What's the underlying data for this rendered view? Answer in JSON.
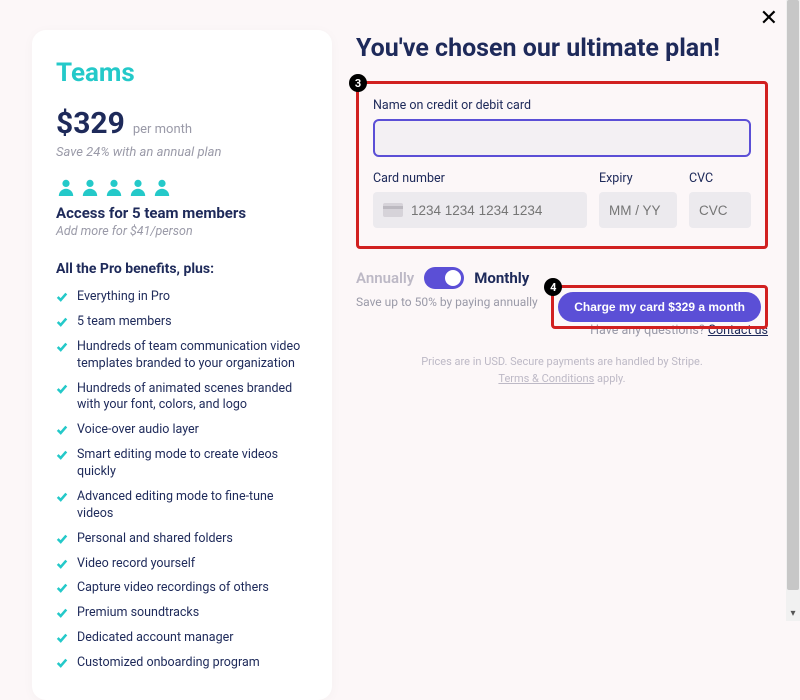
{
  "close_label": "✕",
  "plan": {
    "name": "Teams",
    "price": "$329",
    "per": "per month",
    "save_line": "Save 24% with an annual plan",
    "access_title": "Access for 5 team members",
    "access_sub": "Add more for $41/person",
    "benefits_title": "All the Pro benefits, plus:",
    "benefits": [
      "Everything in Pro",
      "5 team members",
      "Hundreds of team communication video templates branded to your organization",
      "Hundreds of animated scenes branded with your font, colors, and logo",
      "Voice-over audio layer",
      "Smart editing mode to create videos quickly",
      "Advanced editing mode to fine-tune videos",
      "Personal and shared folders",
      "Video record yourself",
      "Capture video recordings of others",
      "Premium soundtracks",
      "Dedicated account manager",
      "Customized onboarding program"
    ]
  },
  "checkout": {
    "headline": "You've chosen our ultimate plan!",
    "name_label": "Name on credit or debit card",
    "name_value": "",
    "card_label": "Card number",
    "card_placeholder": "1234 1234 1234 1234",
    "expiry_label": "Expiry",
    "expiry_placeholder": "MM / YY",
    "cvc_label": "CVC",
    "cvc_placeholder": "CVC",
    "toggle_off": "Annually",
    "toggle_on": "Monthly",
    "charge_btn": "Charge my card $329 a month",
    "save_annually": "Save up to 50% by paying annually",
    "questions_prefix": "Have any questions? ",
    "questions_link": "Contact us",
    "footer_line1": "Prices are in USD. Secure payments are handled by Stripe.",
    "footer_terms": "Terms & Conditions",
    "footer_apply": " apply."
  },
  "callouts": {
    "form": "3",
    "button": "4"
  }
}
